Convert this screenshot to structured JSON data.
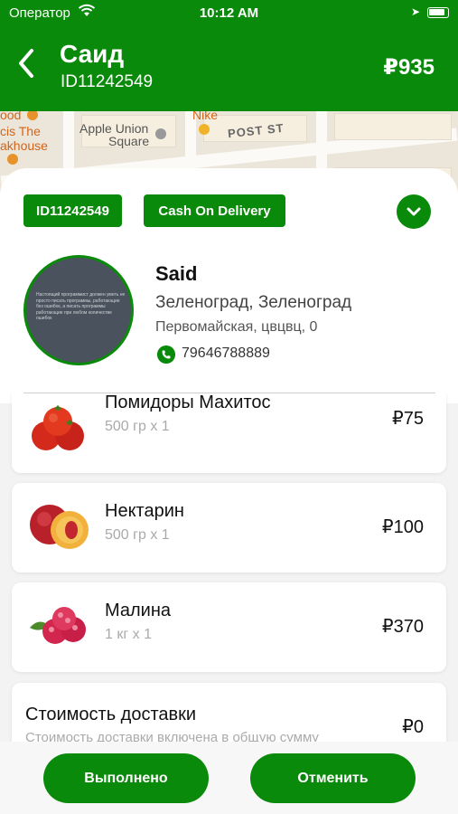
{
  "status_bar": {
    "carrier": "Оператор",
    "time": "10:12 AM"
  },
  "header": {
    "title": "Саид",
    "subtitle": "ID11242549",
    "total": "₽935"
  },
  "map": {
    "labels": {
      "food": "ood",
      "apple": "Apple Union",
      "square": "Square",
      "nike": "Nike",
      "post": "POST ST",
      "cheese": "cis The",
      "steak": "akhouse"
    }
  },
  "order": {
    "id_badge": "ID11242549",
    "payment_badge": "Cash On Delivery",
    "customer": {
      "name": "Said",
      "city": "Зеленоград, Зеленоград",
      "street": "Первомайская, цвцвц, 0",
      "phone": "79646788889",
      "avatar_text": "Настоящий программист должен уметь не просто писать программы, работающие без ошибок, а писать программы работающие при любом количестве ошибок"
    }
  },
  "items": [
    {
      "name": "Помидоры Махитос",
      "qty": "500 гр x 1",
      "price": "₽75",
      "icon": "tomato-icon"
    },
    {
      "name": "Нектарин",
      "qty": "500 гр x 1",
      "price": "₽100",
      "icon": "nectarine-icon"
    },
    {
      "name": "Малина",
      "qty": "1 кг x 1",
      "price": "₽370",
      "icon": "raspberry-icon"
    }
  ],
  "delivery": {
    "title": "Стоимость доставки",
    "note": "Стоимость доставки включена в общую сумму",
    "price": "₽0"
  },
  "actions": {
    "done": "Выполнено",
    "cancel": "Отменить"
  },
  "colors": {
    "brand": "#0a8a0a",
    "background": "#f3f3f3",
    "card": "#ffffff"
  }
}
